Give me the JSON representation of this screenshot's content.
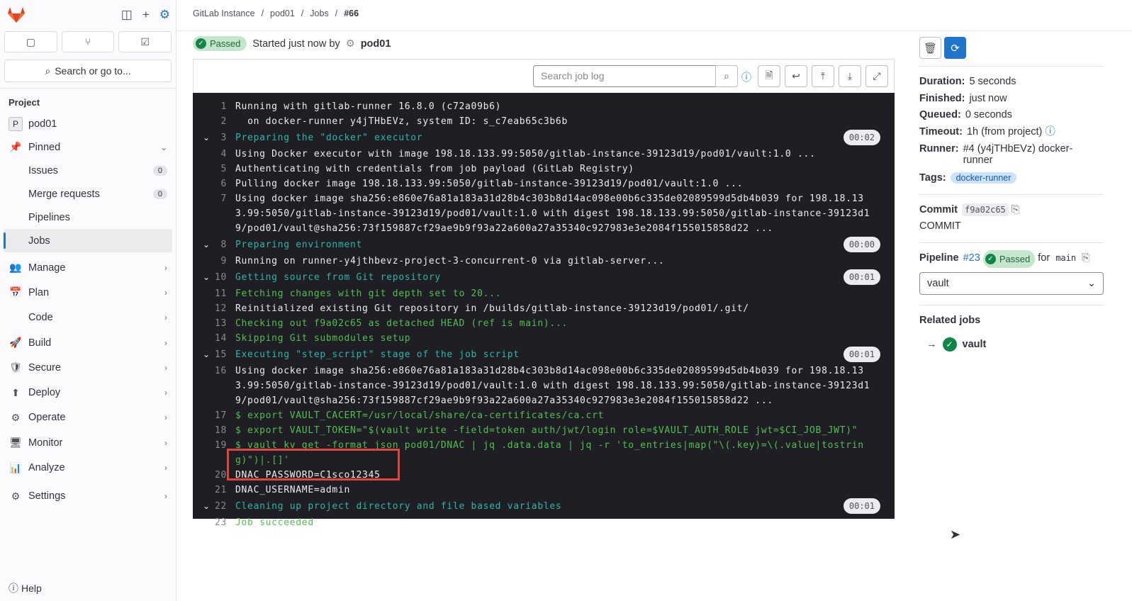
{
  "sidebar": {
    "search": "Search or go to...",
    "section": "Project",
    "project_initial": "P",
    "project": "pod01",
    "pinned": "Pinned",
    "pinned_items": [
      {
        "label": "Issues",
        "count": "0"
      },
      {
        "label": "Merge requests",
        "count": "0"
      },
      {
        "label": "Pipelines"
      },
      {
        "label": "Jobs"
      }
    ],
    "groups": [
      "Manage",
      "Plan",
      "Code",
      "Build",
      "Secure",
      "Deploy",
      "Operate",
      "Monitor",
      "Analyze",
      "Settings"
    ],
    "help": "Help"
  },
  "breadcrumb": [
    "GitLab Instance",
    "pod01",
    "Jobs",
    "#66"
  ],
  "header": {
    "status": "Passed",
    "started": "Started just now by",
    "user": "pod01"
  },
  "log_toolbar": {
    "search_placeholder": "Search job log"
  },
  "log": [
    {
      "n": "1",
      "t": "Running with gitlab-runner 16.8.0 (c72a09b6)"
    },
    {
      "n": "2",
      "t": "  on docker-runner y4jTHbEVz, system ID: s_c7eab65c3b6b"
    },
    {
      "n": "3",
      "t": "Preparing the \"docker\" executor",
      "type": "section",
      "dur": "00:02"
    },
    {
      "n": "4",
      "t": "Using Docker executor with image 198.18.133.99:5050/gitlab-instance-39123d19/pod01/vault:1.0 ..."
    },
    {
      "n": "5",
      "t": "Authenticating with credentials from job payload (GitLab Registry)"
    },
    {
      "n": "6",
      "t": "Pulling docker image 198.18.133.99:5050/gitlab-instance-39123d19/pod01/vault:1.0 ..."
    },
    {
      "n": "7",
      "t": "Using docker image sha256:e860e76a81a183a31d28b4c303b8d14ac098e00b6c335de02089599d5db4b039 for 198.18.133.99:5050/gitlab-instance-39123d19/pod01/vault:1.0 with digest 198.18.133.99:5050/gitlab-instance-39123d19/pod01/vault@sha256:73f159887cf29ae9b9f93a22a600a27a35340c927983e3e2084f155015858d22 ..."
    },
    {
      "n": "8",
      "t": "Preparing environment",
      "type": "section",
      "dur": "00:00"
    },
    {
      "n": "9",
      "t": "Running on runner-y4jthbevz-project-3-concurrent-0 via gitlab-server..."
    },
    {
      "n": "10",
      "t": "Getting source from Git repository",
      "type": "section",
      "dur": "00:01"
    },
    {
      "n": "11",
      "t": "Fetching changes with git depth set to 20...",
      "type": "green"
    },
    {
      "n": "12",
      "t": "Reinitialized existing Git repository in /builds/gitlab-instance-39123d19/pod01/.git/"
    },
    {
      "n": "13",
      "t": "Checking out f9a02c65 as detached HEAD (ref is main)...",
      "type": "green"
    },
    {
      "n": "14",
      "t": "Skipping Git submodules setup",
      "type": "green"
    },
    {
      "n": "15",
      "t": "Executing \"step_script\" stage of the job script",
      "type": "section",
      "dur": "00:01"
    },
    {
      "n": "16",
      "t": "Using docker image sha256:e860e76a81a183a31d28b4c303b8d14ac098e00b6c335de02089599d5db4b039 for 198.18.133.99:5050/gitlab-instance-39123d19/pod01/vault:1.0 with digest 198.18.133.99:5050/gitlab-instance-39123d19/pod01/vault@sha256:73f159887cf29ae9b9f93a22a600a27a35340c927983e3e2084f155015858d22 ..."
    },
    {
      "n": "17",
      "t": "$ export VAULT_CACERT=/usr/local/share/ca-certificates/ca.crt",
      "type": "green"
    },
    {
      "n": "18",
      "t": "$ export VAULT_TOKEN=\"$(vault write -field=token auth/jwt/login role=$VAULT_AUTH_ROLE jwt=$CI_JOB_JWT)\"",
      "type": "green"
    },
    {
      "n": "19",
      "t": "$ vault kv get -format json pod01/DNAC | jq .data.data | jq -r 'to_entries|map(\"\\(.key)=\\(.value|tostring)\")|.[]'",
      "type": "green"
    },
    {
      "n": "20",
      "t": "DNAC_PASSWORD=C1sco12345"
    },
    {
      "n": "21",
      "t": "DNAC_USERNAME=admin"
    },
    {
      "n": "22",
      "t": "Cleaning up project directory and file based variables",
      "type": "section",
      "dur": "00:01"
    },
    {
      "n": "23",
      "t": "Job succeeded",
      "type": "green"
    }
  ],
  "details": {
    "duration_label": "Duration:",
    "duration": "5 seconds",
    "finished_label": "Finished:",
    "finished": "just now",
    "queued_label": "Queued:",
    "queued": "0 seconds",
    "timeout_label": "Timeout:",
    "timeout": "1h (from project)",
    "runner_label": "Runner:",
    "runner": "#4 (y4jTHbEVz) docker-runner",
    "tags_label": "Tags:",
    "tag": "docker-runner",
    "commit_label": "Commit",
    "commit_sha": "f9a02c65",
    "commit_title": "COMMIT",
    "pipeline_label": "Pipeline",
    "pipeline_id": "#23",
    "pipeline_status": "Passed",
    "for": "for",
    "branch": "main",
    "stage": "vault",
    "related_label": "Related jobs",
    "related_job": "vault"
  }
}
